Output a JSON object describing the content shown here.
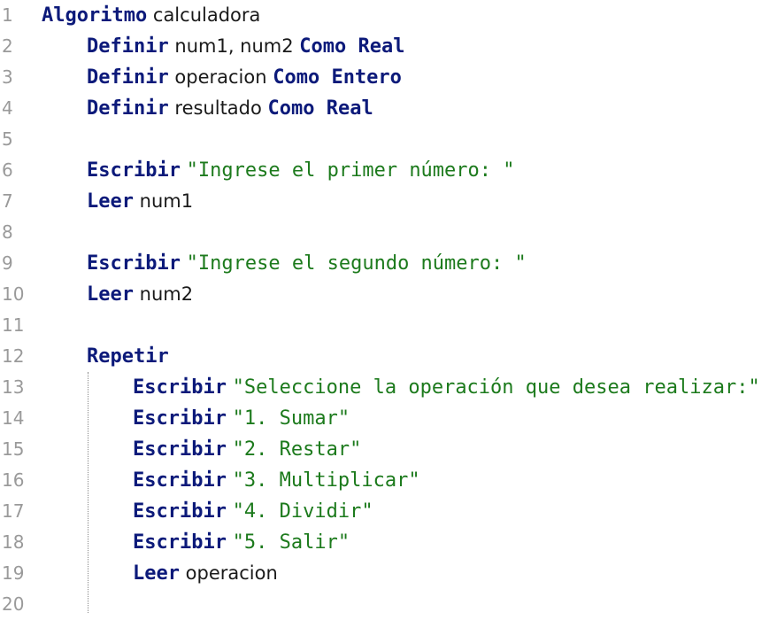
{
  "editor": {
    "lines": [
      {
        "num": "1",
        "tokens": [
          {
            "t": "Algoritmo",
            "k": "kw"
          },
          {
            "t": " calculadora",
            "k": "id"
          }
        ]
      },
      {
        "num": "2",
        "tokens": [
          {
            "t": "Definir",
            "k": "kw"
          },
          {
            "t": " num1, num2 ",
            "k": "id"
          },
          {
            "t": "Como Real",
            "k": "kw"
          }
        ]
      },
      {
        "num": "3",
        "tokens": [
          {
            "t": "Definir",
            "k": "kw"
          },
          {
            "t": " operacion ",
            "k": "id"
          },
          {
            "t": "Como Entero",
            "k": "kw"
          }
        ]
      },
      {
        "num": "4",
        "tokens": [
          {
            "t": "Definir",
            "k": "kw"
          },
          {
            "t": " resultado ",
            "k": "id"
          },
          {
            "t": "Como Real",
            "k": "kw"
          }
        ]
      },
      {
        "num": "5",
        "tokens": []
      },
      {
        "num": "6",
        "tokens": [
          {
            "t": "Escribir",
            "k": "kw"
          },
          {
            "t": " ",
            "k": "id"
          },
          {
            "t": "\"Ingrese el primer número: \"",
            "k": "str"
          }
        ]
      },
      {
        "num": "7",
        "tokens": [
          {
            "t": "Leer",
            "k": "kw"
          },
          {
            "t": " num1",
            "k": "id"
          }
        ]
      },
      {
        "num": "8",
        "tokens": []
      },
      {
        "num": "9",
        "tokens": [
          {
            "t": "Escribir",
            "k": "kw"
          },
          {
            "t": " ",
            "k": "id"
          },
          {
            "t": "\"Ingrese el segundo número: \"",
            "k": "str"
          }
        ]
      },
      {
        "num": "10",
        "tokens": [
          {
            "t": "Leer",
            "k": "kw"
          },
          {
            "t": " num2",
            "k": "id"
          }
        ]
      },
      {
        "num": "11",
        "tokens": []
      },
      {
        "num": "12",
        "tokens": [
          {
            "t": "Repetir",
            "k": "kw"
          }
        ]
      },
      {
        "num": "13",
        "tokens": [
          {
            "t": "Escribir",
            "k": "kw"
          },
          {
            "t": " ",
            "k": "id"
          },
          {
            "t": "\"Seleccione la operación que desea realizar:\"",
            "k": "str"
          }
        ]
      },
      {
        "num": "14",
        "tokens": [
          {
            "t": "Escribir",
            "k": "kw"
          },
          {
            "t": " ",
            "k": "id"
          },
          {
            "t": "\"1. Sumar\"",
            "k": "str"
          }
        ]
      },
      {
        "num": "15",
        "tokens": [
          {
            "t": "Escribir",
            "k": "kw"
          },
          {
            "t": " ",
            "k": "id"
          },
          {
            "t": "\"2. Restar\"",
            "k": "str"
          }
        ]
      },
      {
        "num": "16",
        "tokens": [
          {
            "t": "Escribir",
            "k": "kw"
          },
          {
            "t": " ",
            "k": "id"
          },
          {
            "t": "\"3. Multiplicar\"",
            "k": "str"
          }
        ]
      },
      {
        "num": "17",
        "tokens": [
          {
            "t": "Escribir",
            "k": "kw"
          },
          {
            "t": " ",
            "k": "id"
          },
          {
            "t": "\"4. Dividir\"",
            "k": "str"
          }
        ]
      },
      {
        "num": "18",
        "tokens": [
          {
            "t": "Escribir",
            "k": "kw"
          },
          {
            "t": " ",
            "k": "id"
          },
          {
            "t": "\"5. Salir\"",
            "k": "str"
          }
        ]
      },
      {
        "num": "19",
        "tokens": [
          {
            "t": "Leer",
            "k": "kw"
          },
          {
            "t": " operacion",
            "k": "id"
          }
        ]
      },
      {
        "num": "20",
        "tokens": []
      }
    ]
  },
  "colors": {
    "keyword": "#0c1a7a",
    "string": "#1c7a1c",
    "identifier": "#1a1a1a",
    "line_number": "#9a9a9a",
    "background": "#ffffff"
  }
}
